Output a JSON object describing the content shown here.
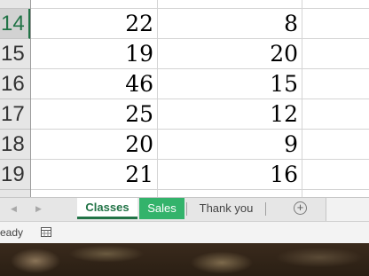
{
  "grid": {
    "rows": [
      {
        "row": "14",
        "a": "22",
        "b": "8",
        "selected": true
      },
      {
        "row": "15",
        "a": "19",
        "b": "20"
      },
      {
        "row": "16",
        "a": "46",
        "b": "15"
      },
      {
        "row": "17",
        "a": "25",
        "b": "12"
      },
      {
        "row": "18",
        "a": "20",
        "b": "9"
      },
      {
        "row": "19",
        "a": "21",
        "b": "16"
      }
    ]
  },
  "tabs": {
    "classes": "Classes",
    "sales": "Sales",
    "thank_you": "Thank you",
    "add_sheet_symbol": "+"
  },
  "tab_colors": {
    "active_text": "#217346",
    "sales_fill": "#33b36b"
  },
  "status": {
    "text": "eady"
  },
  "icons": {
    "nav_left": "chevron-left-icon",
    "nav_right": "chevron-right-icon",
    "add_sheet": "plus-circle-icon",
    "macro": "record-macro-icon"
  }
}
